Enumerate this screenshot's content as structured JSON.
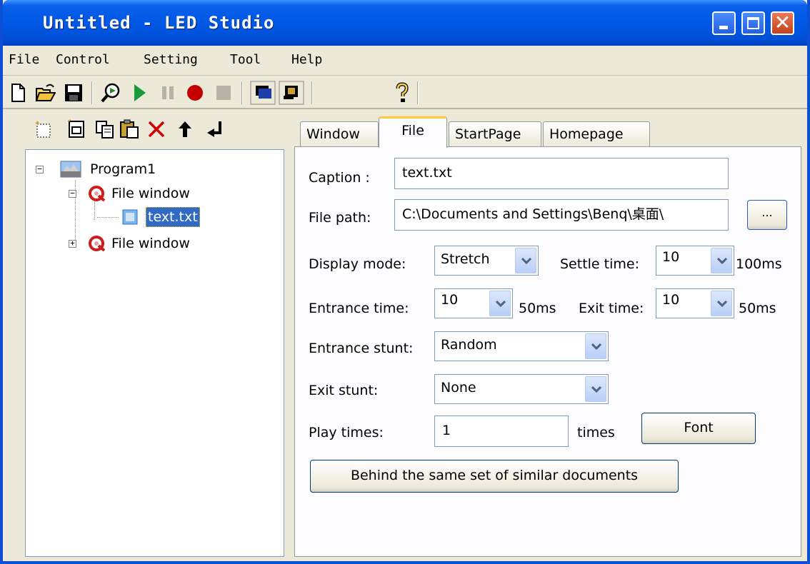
{
  "window": {
    "title": "Untitled - LED Studio"
  },
  "menu": [
    "File",
    "Control",
    "Setting",
    "Tool",
    "Help"
  ],
  "toolbar_icons": [
    "new-icon",
    "open-icon",
    "save-icon",
    "preview-icon",
    "play-icon",
    "pause-icon",
    "record-icon",
    "stop-icon",
    "window-mode-icon",
    "fullscreen-icon",
    "help-icon"
  ],
  "tree_toolbar_icons": [
    "new-node-icon",
    "new-window-icon",
    "copy-icon",
    "paste-icon",
    "delete-icon",
    "move-up-icon",
    "move-down-icon"
  ],
  "tree": {
    "program": "Program1",
    "window1": "File window",
    "file": "text.txt",
    "window2": "File window"
  },
  "tabs": [
    "Window",
    "File",
    "StartPage",
    "Homepage"
  ],
  "form": {
    "caption_label": "Caption :",
    "caption_value": "text.txt",
    "filepath_label": "File path:",
    "filepath_value": "C:\\Documents and Settings\\Benq\\桌面\\",
    "browse_label": "...",
    "display_mode_label": "Display mode:",
    "display_mode_value": "Stretch",
    "settle_time_label": "Settle time:",
    "settle_time_value": "10",
    "settle_time_unit": "100ms",
    "entrance_time_label": "Entrance time:",
    "entrance_time_value": "10",
    "entrance_time_unit": "50ms",
    "exit_time_label": "Exit time:",
    "exit_time_value": "10",
    "exit_time_unit": "50ms",
    "entrance_stunt_label": "Entrance stunt:",
    "entrance_stunt_value": "Random",
    "exit_stunt_label": "Exit stunt:",
    "exit_stunt_value": "None",
    "play_times_label": "Play times:",
    "play_times_value": "1",
    "play_times_unit": "times",
    "font_button": "Font",
    "same_set_button": "Behind the same set of similar documents"
  },
  "colors": {
    "titlebar": "#0058e6",
    "selection": "#316ac5",
    "tab_highlight": "#ffc83c"
  }
}
